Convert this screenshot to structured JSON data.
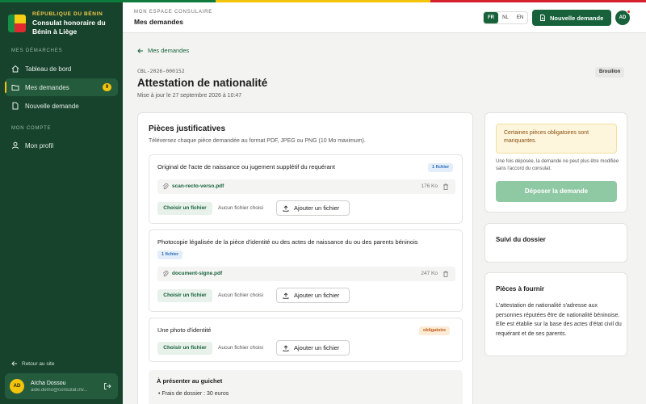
{
  "brand": {
    "supertitle": "RÉPUBLIQUE DU BÉNIN",
    "name": "Consulat honoraire du Bénin à Liège"
  },
  "sidebar": {
    "section_requests": "MES DÉMARCHES",
    "items": [
      {
        "label": "Tableau de bord",
        "icon": "home-icon"
      },
      {
        "label": "Mes demandes",
        "icon": "folder-icon",
        "badge": "9",
        "active": true
      },
      {
        "label": "Nouvelle demande",
        "icon": "file-plus-icon"
      }
    ],
    "section_account": "MON COMPTE",
    "profile_label": "Mon profil",
    "back_to_site": "Retour au site",
    "user": {
      "initials": "AD",
      "name": "Aïcha Dossou",
      "email": "aide.demo@consulat.inv..."
    }
  },
  "header": {
    "kicker": "MON ESPACE CONSULAIRE",
    "title": "Mes demandes",
    "languages": [
      "FR",
      "NL",
      "EN"
    ],
    "active_language": "FR",
    "new_request_label": "Nouvelle demande",
    "avatar_initials": "AD"
  },
  "request": {
    "back_label": "Mes demandes",
    "reference": "CBL-2026-000152",
    "title": "Attestation de nationalité",
    "updated": "Mise à jour le 27 septembre 2026 à 10:47",
    "status": "Brouillon"
  },
  "documents": {
    "title": "Pièces justificatives",
    "subtitle": "Téléversez chaque pièce demandée au format PDF, JPEG ou PNG (10 Mo maximum).",
    "choose_label": "Choisir un fichier",
    "no_file_label": "Aucun fichier choisi",
    "add_label": "Ajouter un fichier",
    "pieces": [
      {
        "title": "Original de l'acte de naissance ou jugement supplétif du requérant",
        "tag": "1 fichier",
        "file_name": "scan-recto-verso.pdf",
        "file_size": "176 Ko"
      },
      {
        "title": "Photocopie légalisée de la pièce d'identité ou des actes de naissance du ou des parents béninois",
        "tag": "1 fichier",
        "file_name": "document-signe.pdf",
        "file_size": "247 Ko"
      },
      {
        "title": "Une photo d'identité",
        "tag": "obligatoire"
      }
    ],
    "counter": {
      "title": "À présenter au guichet",
      "items": [
        "Frais de dossier : 30 euros"
      ]
    }
  },
  "submit": {
    "warning": "Certaines pièces obligatoires sont manquantes.",
    "note": "Une fois déposée, la demande ne peut plus être modifiée sans l'accord du consulat.",
    "button_label": "Déposer la demande"
  },
  "follow": {
    "title": "Suivi du dossier"
  },
  "pieces_info": {
    "title": "Pièces à fournir",
    "text": "L'attestation de nationalité s'adresse aux personnes réputées être de nationalité béninoise. Elle est établie sur la base des actes d'état civil du requérant et de ses parents."
  },
  "colors": {
    "sidebar_bg": "#17432c",
    "primary": "#17623b",
    "accent": "#f2c40c",
    "danger": "#d6202b"
  }
}
